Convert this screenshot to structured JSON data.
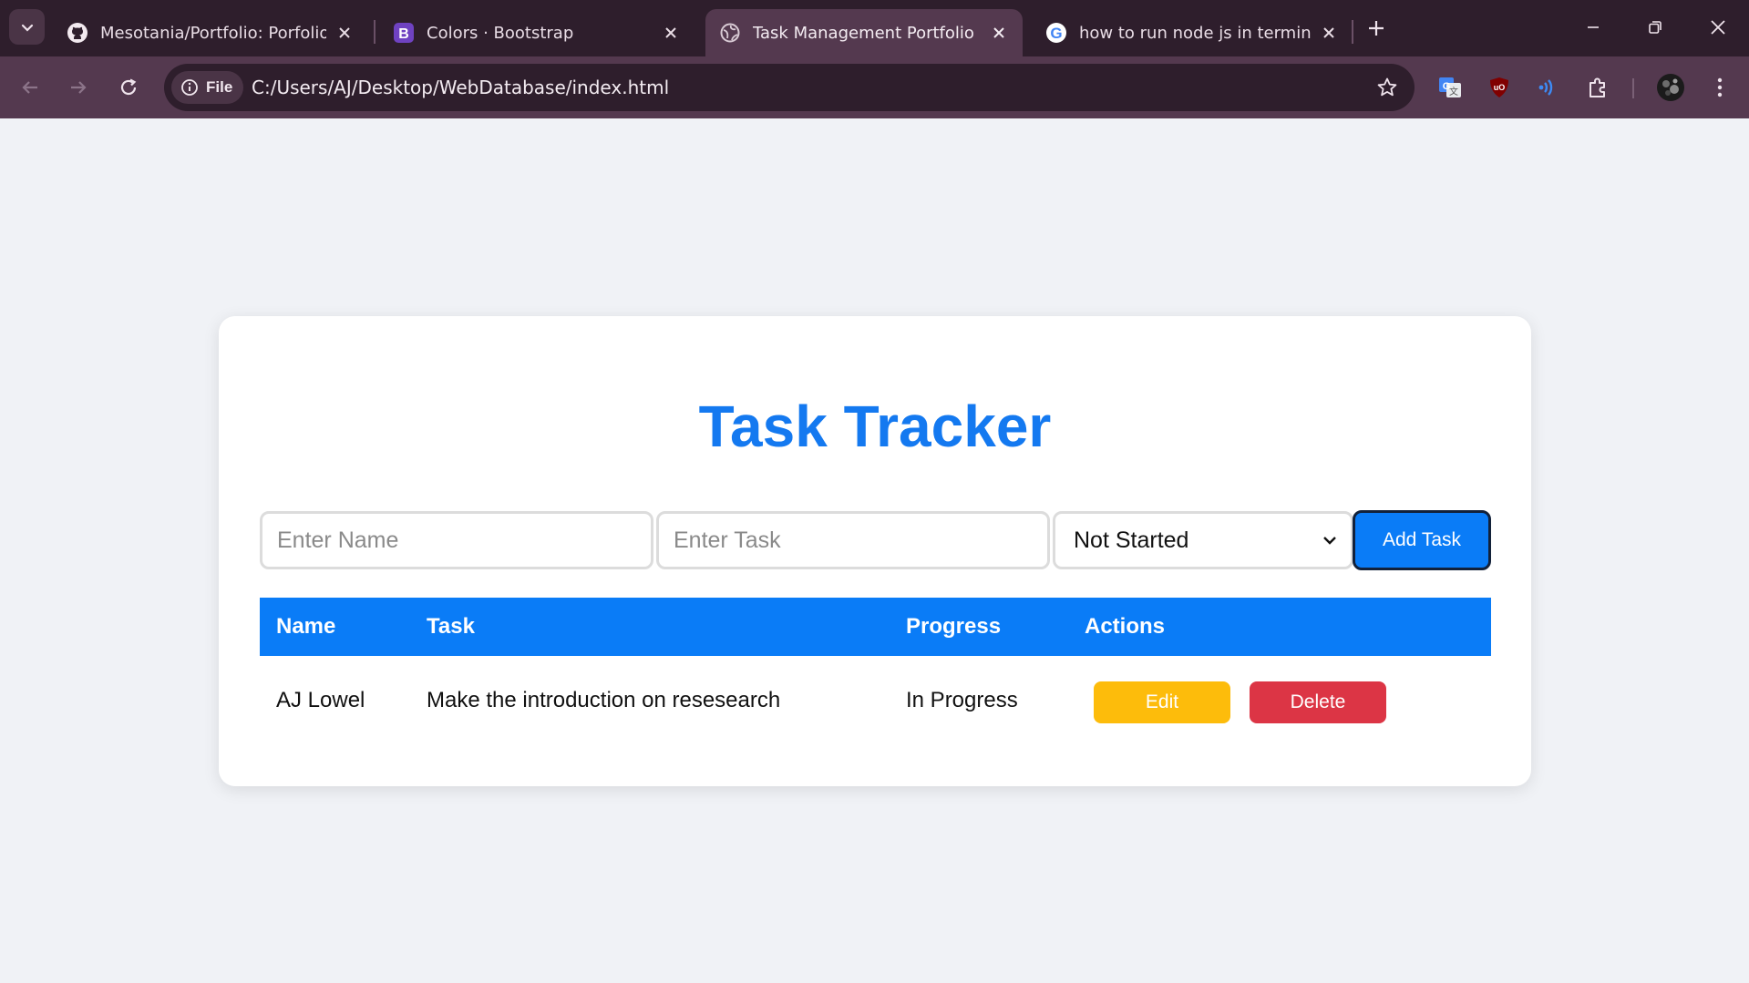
{
  "browser": {
    "tabs": [
      {
        "title": "Mesotania/Portfolio: Porfolio W",
        "icon": "github-icon"
      },
      {
        "title": "Colors · Bootstrap",
        "icon": "bootstrap-icon"
      },
      {
        "title": "Task Management Portfolio",
        "icon": "globe-icon",
        "active": true
      },
      {
        "title": "how to run node js in terminal -",
        "icon": "google-icon"
      }
    ],
    "chip_label": "File",
    "url": "C:/Users/AJ/Desktop/WebDatabase/index.html",
    "colors": {
      "tabstrip": "#2e1e2c",
      "toolbar": "#54394f"
    }
  },
  "app": {
    "title": "Task Tracker",
    "name_placeholder": "Enter Name",
    "task_placeholder": "Enter Task",
    "progress_selected": "Not Started",
    "add_button": "Add Task",
    "table": {
      "headers": [
        "Name",
        "Task",
        "Progress",
        "Actions"
      ],
      "rows": [
        {
          "name": "AJ Lowel",
          "task": "Make the introduction on resesearch",
          "progress": "In Progress",
          "edit": "Edit",
          "delete": "Delete"
        }
      ]
    },
    "colors": {
      "primary": "#0a7cf7",
      "edit": "#fdbc0b",
      "delete": "#dc3545",
      "background": "#f0f2f6"
    }
  }
}
